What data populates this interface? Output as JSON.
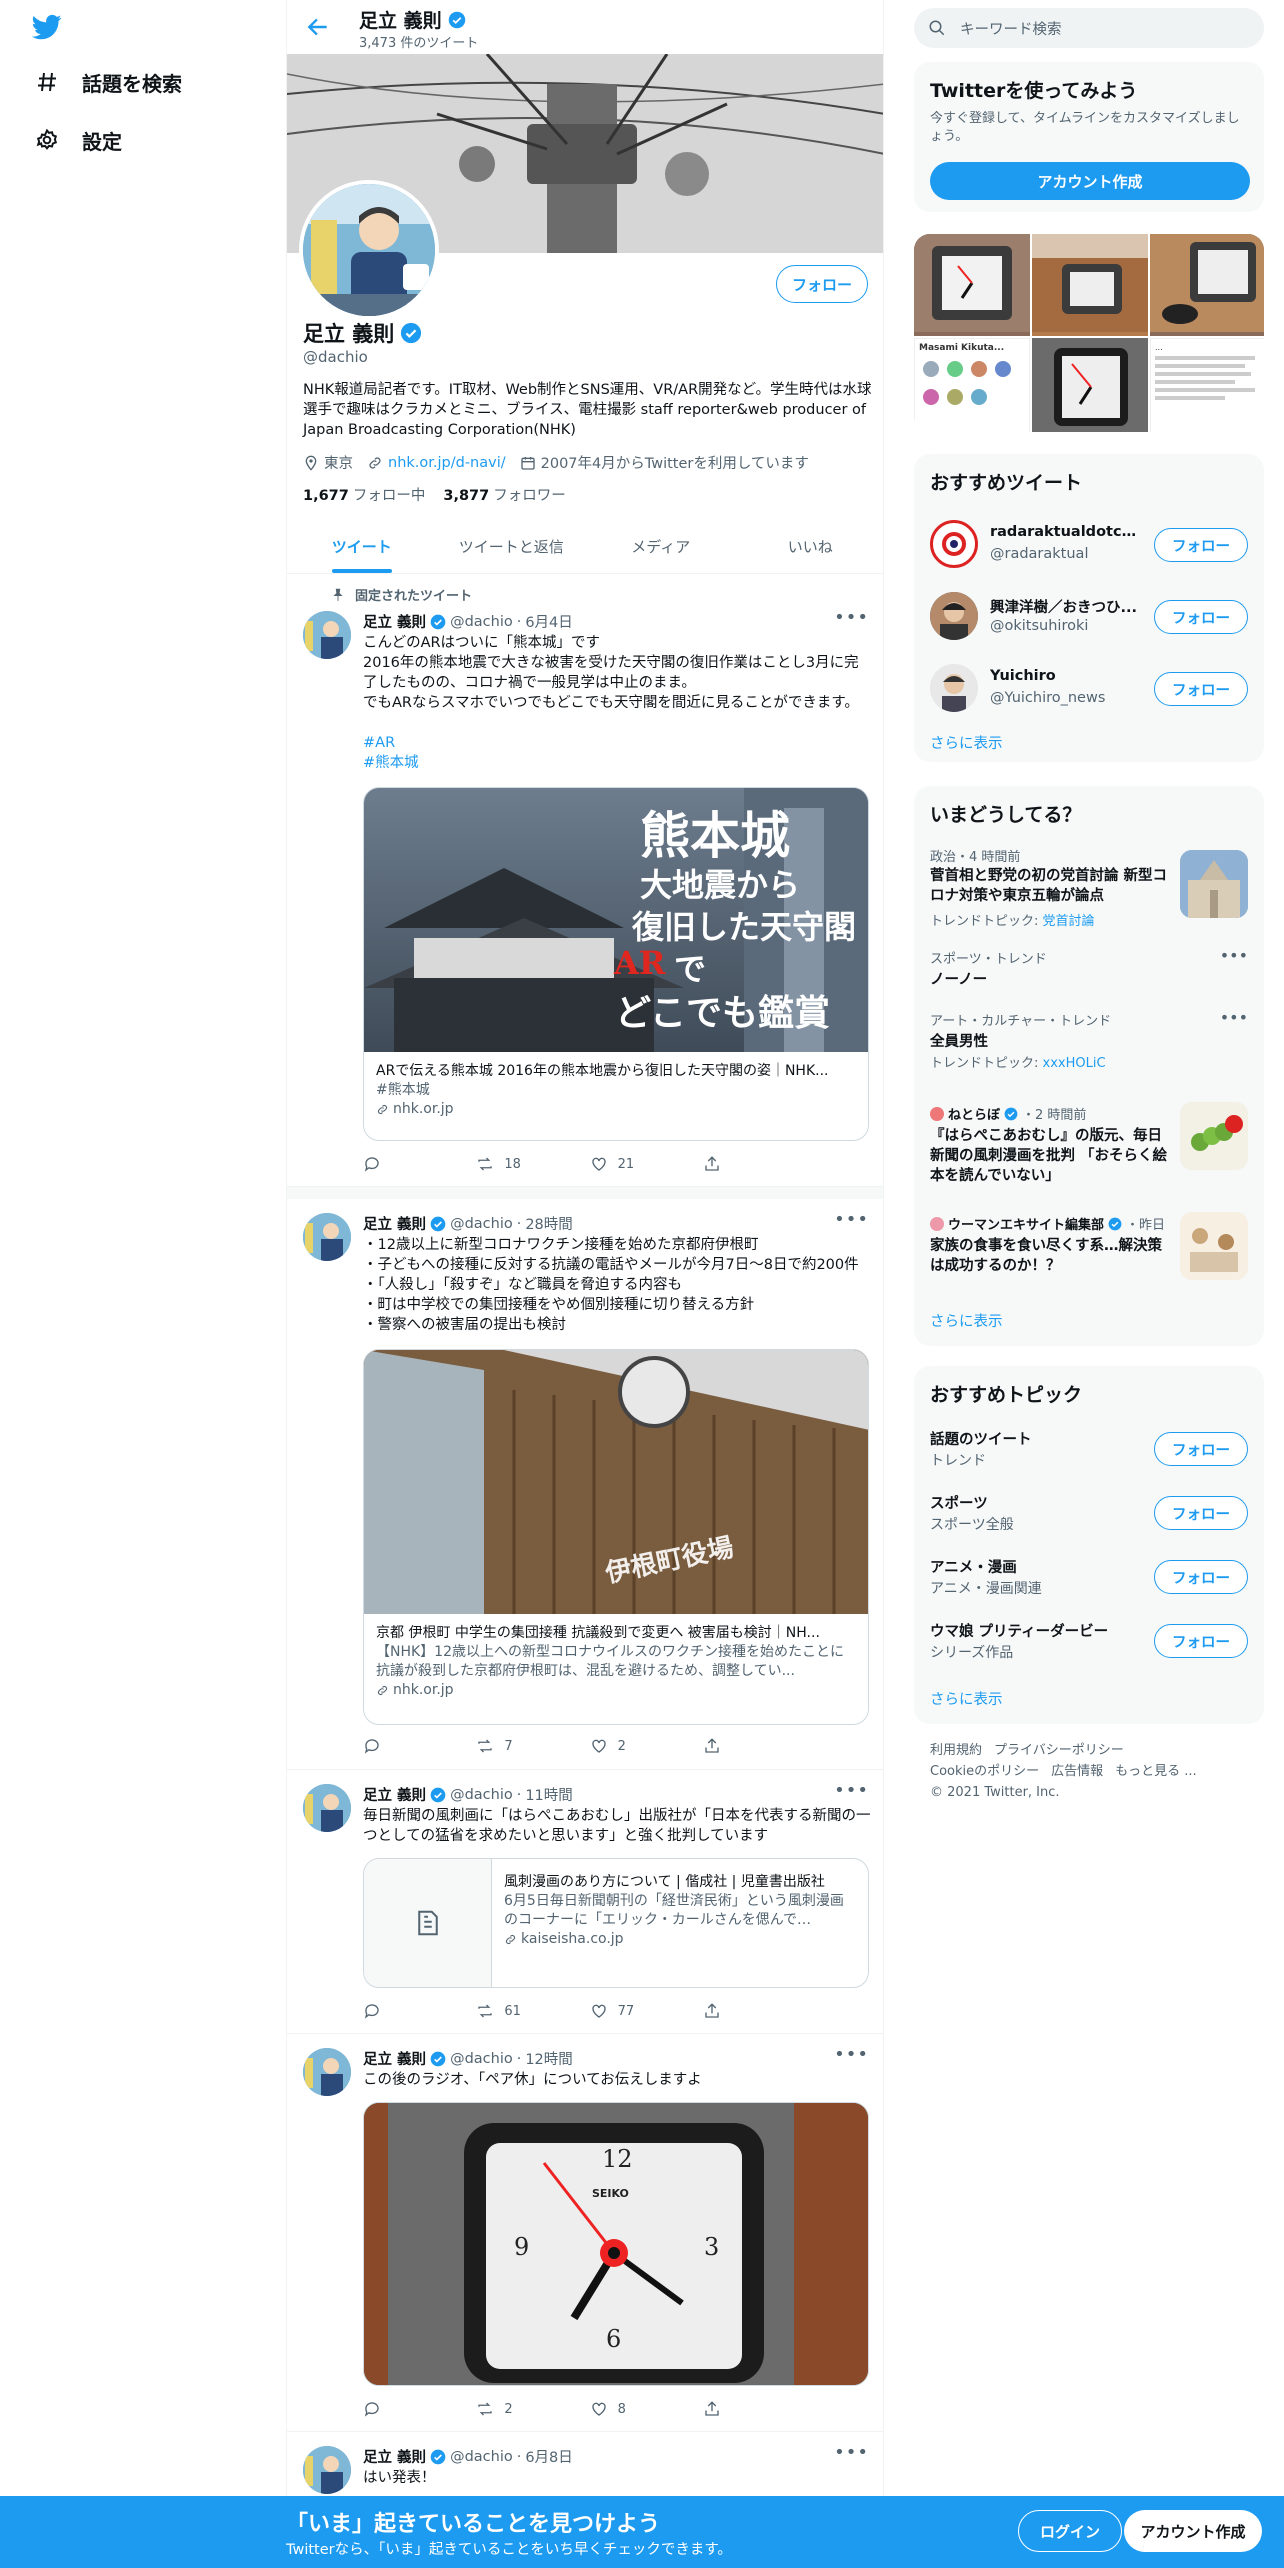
{
  "nav": {
    "explore_label": "話題を検索",
    "settings_label": "設定"
  },
  "profile": {
    "name": "足立 義則",
    "tweet_count": "3,473 件のツイート",
    "handle": "@dachio",
    "bio": "NHK報道局記者です。IT取材、Web制作とSNS運用、VR/AR開発など。学生時代は水球選手で趣味はクラカメとミニ、ブライス、電柱撮影 staff reporter&web producer of Japan Broadcasting Corporation(NHK)",
    "location": "東京",
    "url": "nhk.or.jp/d-navi/",
    "joined": "2007年4月からTwitterを利用しています",
    "following_count": "1,677",
    "following_label": "フォロー中",
    "followers_count": "3,877",
    "followers_label": "フォロワー",
    "follow_button": "フォロー"
  },
  "tabs": [
    "ツイート",
    "ツイートと返信",
    "メディア",
    "いいね"
  ],
  "pinned_label": "固定されたツイート",
  "tweets": [
    {
      "name": "足立 義則",
      "handle": "@dachio",
      "time": "6月4日",
      "text": "こんどのARはついに「熊本城」です\n2016年の熊本地震で大きな被害を受けた天守閣の復旧作業はことし3月に完了したものの、コロナ禍で一般見学は中止のまま。\nでもARならスマホでいつでもどこでも天守閣を間近に見ることができます。",
      "hashtags": [
        "#AR",
        "#熊本城"
      ],
      "card_image_text_1": "熊本城",
      "card_image_text_2": "大地震から",
      "card_image_text_3": "復旧した天守閣",
      "card_image_text_4": "AR",
      "card_image_text_5": "で",
      "card_image_text_6": "どこでも鑑賞",
      "card_title": "ARで伝える熊本城 2016年の熊本地震から復旧した天守閣の姿｜NHK...",
      "card_tag": "#熊本城",
      "card_domain": "nhk.or.jp",
      "replies": "",
      "retweets": "18",
      "likes": "21"
    },
    {
      "name": "足立 義則",
      "handle": "@dachio",
      "time": "28時間",
      "text": "・12歳以上に新型コロナワクチン接種を始めた京都府伊根町\n・子どもへの接種に反対する抗議の電話やメールが今月7日～8日で約200件\n・「人殺し」「殺すぞ」など職員を脅迫する内容も\n・町は中学校での集団接種をやめ個別接種に切り替える方針\n・警察への被害届の提出も検討",
      "card_image_text": "伊根町役場",
      "card_title": "京都 伊根町 中学生の集団接種 抗議殺到で変更へ 被害届も検討｜NH...",
      "card_desc": "【NHK】12歳以上への新型コロナウイルスのワクチン接種を始めたことに抗議が殺到した京都府伊根町は、混乱を避けるため、調整してい...",
      "card_domain": "nhk.or.jp",
      "replies": "",
      "retweets": "7",
      "likes": "2"
    },
    {
      "name": "足立 義則",
      "handle": "@dachio",
      "time": "11時間",
      "text": "毎日新聞の風刺画に「はらぺこあおむし」出版社が「日本を代表する新聞の一つとしての猛省を求めたいと思います」と強く批判しています",
      "card_title": "風刺漫画のあり方について | 偕成社 | 児童書出版社",
      "card_desc": "6月5日毎日新聞朝刊の「経世済民術」という風刺漫画のコーナーに「エリック・カールさんを偲んで…",
      "card_domain": "kaiseisha.co.jp",
      "replies": "",
      "retweets": "61",
      "likes": "77"
    },
    {
      "name": "足立 義則",
      "handle": "@dachio",
      "time": "12時間",
      "text": "この後のラジオ、「ペア休」についてお伝えしますよ",
      "card_image_text": "SEIKO",
      "clock_numbers": [
        "12",
        "3",
        "6",
        "9"
      ],
      "replies": "",
      "retweets": "2",
      "likes": "8"
    },
    {
      "name": "足立 義則",
      "handle": "@dachio",
      "time": "6月8日",
      "text": "はい発表！"
    }
  ],
  "right": {
    "search_placeholder": "キーワード検索",
    "signup_box": {
      "title": "Twitterを使ってみよう",
      "desc": "今すぐ登録して、タイムラインをカスタマイズしましょう。",
      "button": "アカウント作成"
    },
    "media_grid_texts": [
      "Masami Kikuta...",
      "..."
    ],
    "suggested": {
      "title": "おすすめツイート",
      "users": [
        {
          "name": "radaraktualdotcom",
          "handle": "@radaraktual"
        },
        {
          "name": "興津洋樹／おきつひ...",
          "handle": "@okitsuhiroki"
        },
        {
          "name": "Yuichiro",
          "handle": "@Yuichiro_news"
        }
      ],
      "follow": "フォロー",
      "more": "さらに表示"
    },
    "trends": {
      "title": "いまどうしてる？",
      "items": [
        {
          "meta": "政治・4 時間前",
          "title": "菅首相と野党の初の党首討論 新型コロナ対策や東京五輪が論点",
          "sub": "トレンドトピック: ",
          "link": "党首討論"
        },
        {
          "meta": "スポーツ・トレンド",
          "title": "ノーノー"
        },
        {
          "meta": "アート・カルチャー・トレンド",
          "title": "全員男性",
          "sub": "トレンドトピック: ",
          "link": "xxxHOLiC"
        },
        {
          "meta_user": "ねとらぼ",
          "meta": "・2 時間前",
          "title": "『はらぺこあおむし』の版元、毎日新聞の風刺漫画を批判 「おそらく絵本を読んでいない」"
        },
        {
          "meta_user": "ウーマンエキサイト編集部",
          "meta": "・昨日",
          "title": "家族の食事を食い尽くす系…解決策は成功するのか！？"
        }
      ],
      "more": "さらに表示"
    },
    "topics": {
      "title": "おすすめトピック",
      "items": [
        {
          "title": "話題のツイート",
          "sub": "トレンド"
        },
        {
          "title": "スポーツ",
          "sub": "スポーツ全般"
        },
        {
          "title": "アニメ・漫画",
          "sub": "アニメ・漫画関連"
        },
        {
          "title": "ウマ娘 プリティーダービー",
          "sub": "シリーズ作品"
        }
      ],
      "follow": "フォロー",
      "more": "さらに表示"
    },
    "footer": {
      "terms": "利用規約",
      "privacy": "プライバシーポリシー",
      "cookie": "Cookieのポリシー",
      "ads": "広告情報",
      "more": "もっと見る ...",
      "copyright": "© 2021 Twitter, Inc."
    }
  },
  "bottom": {
    "headline": "「いま」起きていることを見つけよう",
    "sub": "Twitterなら、「いま」起きていることをいち早くチェックできます。",
    "login": "ログイン",
    "signup": "アカウント作成"
  },
  "colors": {
    "accent": "#1d9bf0",
    "text": "#0f1419",
    "muted": "#536471"
  }
}
